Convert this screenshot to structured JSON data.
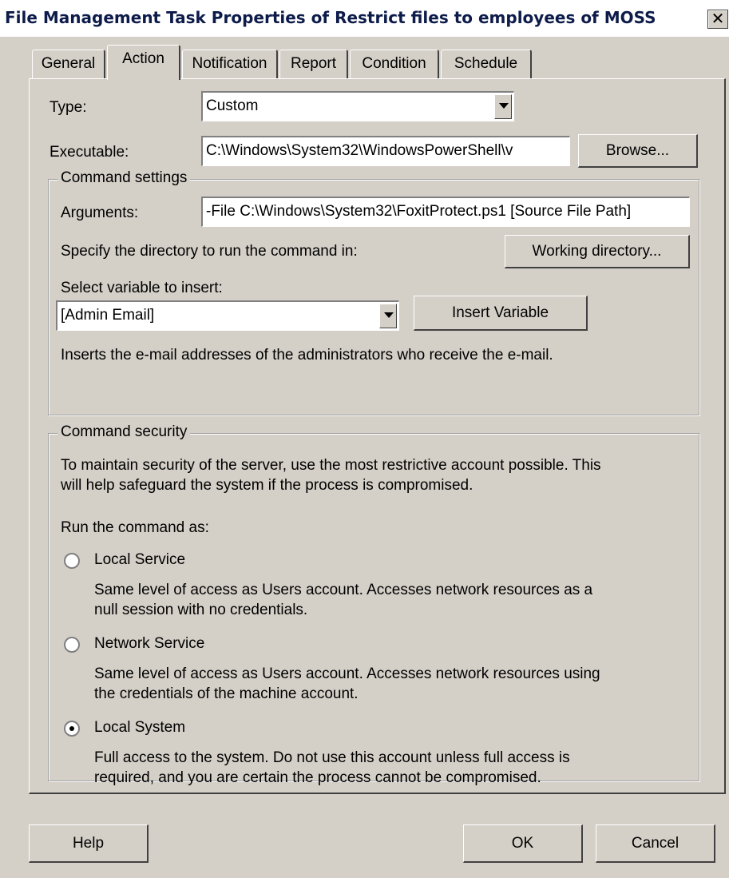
{
  "window": {
    "title": "File Management Task Properties of Restrict files to employees of MOSS",
    "close_glyph": "✕"
  },
  "tabs": [
    {
      "label": "General",
      "active": false
    },
    {
      "label": "Action",
      "active": true
    },
    {
      "label": "Notification",
      "active": false
    },
    {
      "label": "Report",
      "active": false
    },
    {
      "label": "Condition",
      "active": false
    },
    {
      "label": "Schedule",
      "active": false
    }
  ],
  "action": {
    "type_label": "Type:",
    "type_value": "Custom",
    "executable_label": "Executable:",
    "executable_value": "C:\\Windows\\System32\\WindowsPowerShell\\v",
    "browse_label": "Browse..."
  },
  "command_settings": {
    "group_label": "Command settings",
    "arguments_label": "Arguments:",
    "arguments_value": "-File C:\\Windows\\System32\\FoxitProtect.ps1 [Source File Path]",
    "directory_prompt": "Specify the directory to run the command in:",
    "working_directory_button": "Working directory...",
    "variable_label": "Select variable to insert:",
    "variable_value": "[Admin Email]",
    "insert_variable_button": "Insert Variable",
    "variable_description": "Inserts the e-mail addresses of the administrators who receive the e-mail."
  },
  "command_security": {
    "group_label": "Command security",
    "intro_line1": "To maintain security of the server, use the most restrictive account possible. This",
    "intro_line2": "will help safeguard the system if the process is compromised.",
    "run_as_label": "Run the command as:",
    "options": [
      {
        "label": "Local Service",
        "selected": false,
        "desc_line1": "Same level of access as Users account. Accesses network resources as a",
        "desc_line2": "null session with no credentials."
      },
      {
        "label": "Network Service",
        "selected": false,
        "desc_line1": "Same level of access as Users account. Accesses network resources using",
        "desc_line2": "the credentials of the machine account."
      },
      {
        "label": "Local System",
        "selected": true,
        "desc_line1": "Full access to the system. Do not use this account unless full access is",
        "desc_line2": "required, and you are certain the process cannot be compromised."
      }
    ]
  },
  "footer": {
    "help_button": "Help",
    "ok_button": "OK",
    "cancel_button": "Cancel"
  }
}
